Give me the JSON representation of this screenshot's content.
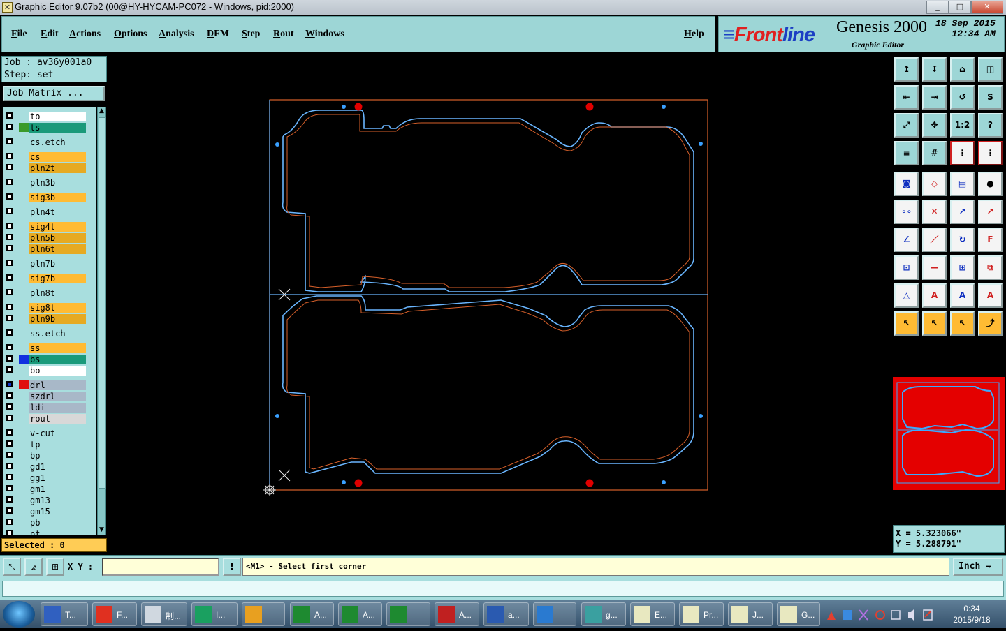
{
  "window": {
    "title": "Graphic Editor 9.07b2 (00@HY-HYCAM-PC072 - Windows, pid:2000)",
    "min": "_",
    "max": "□",
    "close": "✕"
  },
  "menu": {
    "file": "File",
    "edit": "Edit",
    "actions": "Actions",
    "options": "Options",
    "analysis": "Analysis",
    "dfm": "DFM",
    "step": "Step",
    "rout": "Rout",
    "windows": "Windows",
    "help": "Help"
  },
  "brand": {
    "frontline_a": "Front",
    "frontline_b": "line",
    "product": "Genesis 2000",
    "subtitle": "Graphic Editor",
    "date": "18 Sep 2015",
    "time": "12:34 AM"
  },
  "job": {
    "job_line": "Job  : av36y001a0",
    "step_line": "Step: set",
    "matrix_button": "Job Matrix ..."
  },
  "layers": [
    {
      "name": "to",
      "color": "#ffffff",
      "sw": ""
    },
    {
      "name": "ts",
      "color": "#1a9a7a",
      "sw": "#3a9a2a"
    },
    {
      "name": "cs.etch",
      "color": "#a8dede",
      "sw": ""
    },
    {
      "name": "cs",
      "color": "#ffbb33",
      "sw": ""
    },
    {
      "name": "pln2t",
      "color": "#e6aa22",
      "sw": ""
    },
    {
      "name": "pln3b",
      "color": "#a8dede",
      "sw": ""
    },
    {
      "name": "sig3b",
      "color": "#ffbb33",
      "sw": ""
    },
    {
      "name": "pln4t",
      "color": "#a8dede",
      "sw": ""
    },
    {
      "name": "sig4t",
      "color": "#ffbb33",
      "sw": ""
    },
    {
      "name": "pln5b",
      "color": "#e6aa22",
      "sw": ""
    },
    {
      "name": "pln6t",
      "color": "#e6aa22",
      "sw": ""
    },
    {
      "name": "pln7b",
      "color": "#a8dede",
      "sw": ""
    },
    {
      "name": "sig7b",
      "color": "#ffbb33",
      "sw": ""
    },
    {
      "name": "pln8t",
      "color": "#a8dede",
      "sw": ""
    },
    {
      "name": "sig8t",
      "color": "#ffbb33",
      "sw": ""
    },
    {
      "name": "pln9b",
      "color": "#e6aa22",
      "sw": ""
    },
    {
      "name": "ss.etch",
      "color": "#a8dede",
      "sw": ""
    },
    {
      "name": "ss",
      "color": "#ffbb33",
      "sw": ""
    },
    {
      "name": "bs",
      "color": "#1a9a7a",
      "sw": "#1030e0"
    },
    {
      "name": "bo",
      "color": "#ffffff",
      "sw": ""
    },
    {
      "name": "drl",
      "color": "#a8b8c8",
      "sw": "#e01010"
    },
    {
      "name": "szdrl",
      "color": "#a8b8c8",
      "sw": ""
    },
    {
      "name": "ldi",
      "color": "#a8b8c8",
      "sw": ""
    },
    {
      "name": "rout",
      "color": "#d8d8d8",
      "sw": ""
    },
    {
      "name": "v-cut",
      "color": "#a8dede",
      "sw": ""
    },
    {
      "name": "tp",
      "color": "#a8dede",
      "sw": ""
    },
    {
      "name": "bp",
      "color": "#a8dede",
      "sw": ""
    },
    {
      "name": "gd1",
      "color": "#a8dede",
      "sw": ""
    },
    {
      "name": "gg1",
      "color": "#a8dede",
      "sw": ""
    },
    {
      "name": "gm1",
      "color": "#a8dede",
      "sw": ""
    },
    {
      "name": "gm13",
      "color": "#a8dede",
      "sw": ""
    },
    {
      "name": "gm15",
      "color": "#a8dede",
      "sw": ""
    },
    {
      "name": "pb",
      "color": "#a8dede",
      "sw": ""
    },
    {
      "name": "pt",
      "color": "#a8dede",
      "sw": ""
    }
  ],
  "status": {
    "selected": "Selected : 0"
  },
  "coords": {
    "x": "X = 5.323066\"",
    "y": "Y = 5.288791\""
  },
  "command": {
    "xy_label": "X Y :",
    "xy_value": "",
    "prompt": "<M1> - Select first corner",
    "unit": "Inch",
    "warn": "!"
  },
  "tools": [
    "↥",
    "↧",
    "⌂",
    "◫",
    "⇤",
    "⇥",
    "↺",
    "S",
    "⤢",
    "✥",
    "1:2",
    "?",
    "≡",
    "#",
    "⋮",
    "⋮",
    "◙",
    "◇",
    "▤",
    "●",
    "∘∘",
    "✕",
    "↗",
    "↗",
    "∠",
    "／",
    "↻",
    "F",
    "⊡",
    "—",
    "⊞",
    "⧉",
    "△",
    "A",
    "A",
    "A",
    "↖",
    "↖",
    "↖",
    "⤴"
  ],
  "taskbar": {
    "items": [
      "T...",
      "F...",
      "制...",
      "I...",
      "",
      "A...",
      "A...",
      "",
      "A...",
      "a...",
      "",
      "g...",
      "E...",
      "Pr...",
      "J...",
      "G..."
    ],
    "time": "0:34",
    "date": "2015/9/18"
  },
  "colors": {
    "canvas_bg": "#000000",
    "profile": "#d8602a",
    "rout": "#6ab6ff",
    "pad": "#e00000",
    "fiducial": "#3aa0ff"
  }
}
